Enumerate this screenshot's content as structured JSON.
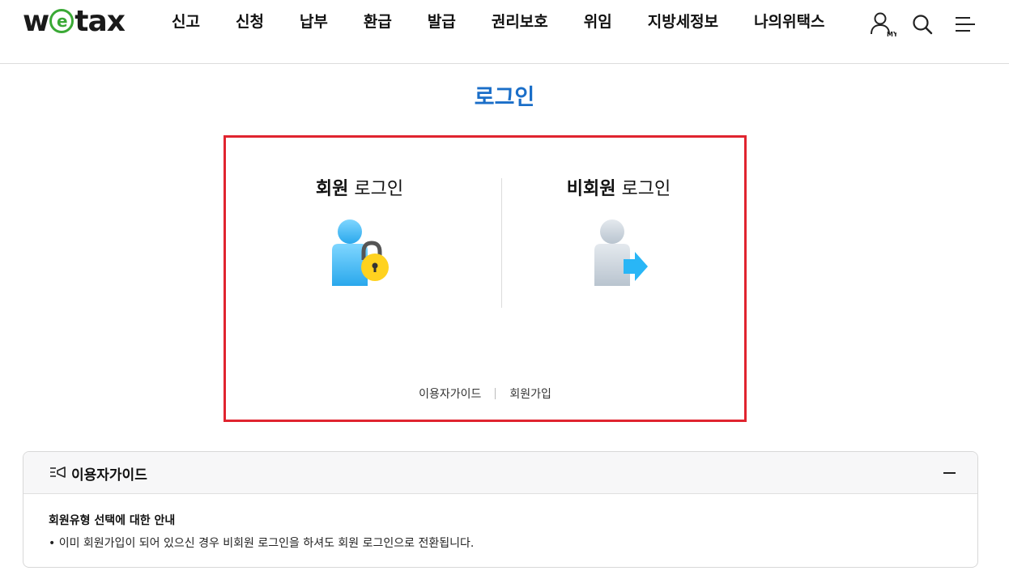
{
  "header": {
    "logo": {
      "pre": "w",
      "e": "e",
      "post": "tax"
    },
    "nav": [
      "신고",
      "신청",
      "납부",
      "환급",
      "발급",
      "권리보호",
      "위임",
      "지방세정보",
      "나의위택스"
    ],
    "my_label": "MY"
  },
  "page_title": "로그인",
  "login": {
    "member": {
      "bold": "회원",
      "rest": " 로그인"
    },
    "guest": {
      "bold": "비회원",
      "rest": " 로그인"
    },
    "links": {
      "guide": "이용자가이드",
      "signup": "회원가입"
    }
  },
  "guide": {
    "title": "이용자가이드",
    "subtitle": "회원유형 선택에 대한 안내",
    "items": [
      "• 이미 회원가입이 되어 있으신 경우 비회원 로그인을 하셔도 회원 로그인으로 전환됩니다."
    ]
  },
  "colors": {
    "accent_blue": "#1a6ec8",
    "highlight_red": "#e0242f",
    "logo_green": "#3aa935",
    "arrow_blue": "#29b6f6",
    "lock_yellow": "#ffd21f"
  },
  "icons": {
    "my": "user-icon",
    "search": "search-icon",
    "menu": "menu-icon",
    "member_login": "user-lock-icon",
    "guest_login": "user-arrow-icon",
    "guide": "megaphone-icon"
  }
}
